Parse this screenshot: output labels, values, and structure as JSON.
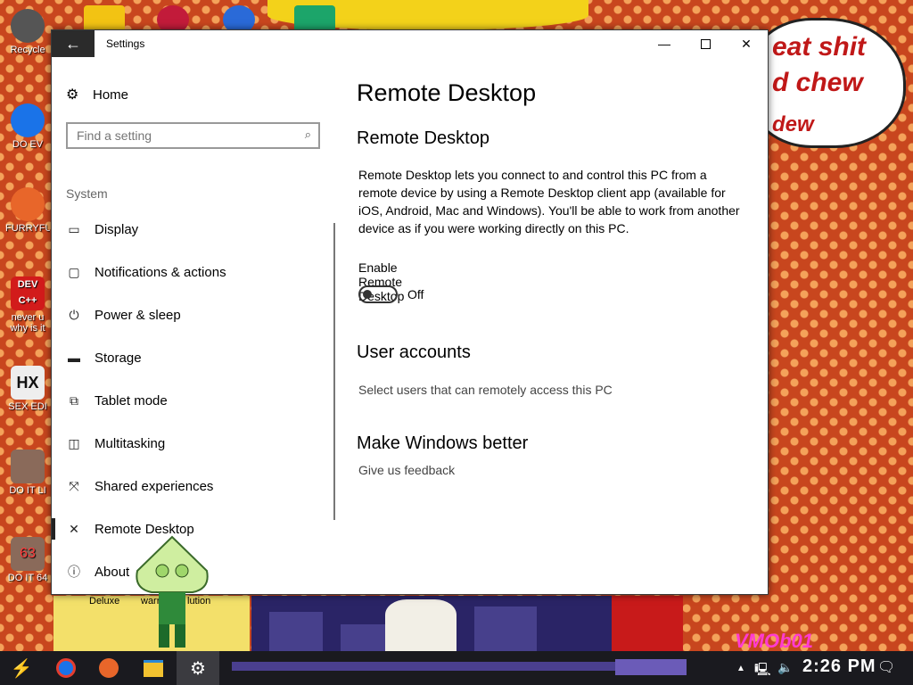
{
  "desktop": {
    "icons": [
      {
        "label": "Recycle",
        "color": "#6b6b6b"
      },
      {
        "label": "DO EV",
        "color": "#1a73e8"
      },
      {
        "label": "FURRYFU",
        "color": "#e8662a"
      },
      {
        "label": "never u",
        "label2": "why is it",
        "color": "#d21b1b",
        "text": "DEV C++"
      },
      {
        "label": "SEX EDI",
        "color": "#eeeeee",
        "text": "HX"
      },
      {
        "label": "DO IT LI",
        "color": "#8a6a5a"
      },
      {
        "label": "DO IT 64",
        "color": "#8a6a5a",
        "text": "63"
      }
    ],
    "bubble_lines": [
      "eat shit",
      "d chew",
      "d",
      "dew"
    ],
    "bottom_labels": [
      "Deluxe",
      "warr",
      "lution"
    ],
    "watermark": "VMOb01"
  },
  "window": {
    "title": "Settings",
    "back_glyph": "←",
    "min_glyph": "—",
    "close_glyph": "✕"
  },
  "sidebar": {
    "home_label": "Home",
    "search_placeholder": "Find a setting",
    "section_label": "System",
    "items": [
      {
        "label": "Display",
        "icon": "display-icon",
        "glyph": "▭"
      },
      {
        "label": "Notifications & actions",
        "icon": "notifications-icon",
        "glyph": "▢"
      },
      {
        "label": "Power & sleep",
        "icon": "power-icon",
        "glyph": "⏻"
      },
      {
        "label": "Storage",
        "icon": "storage-icon",
        "glyph": "▬"
      },
      {
        "label": "Tablet mode",
        "icon": "tablet-mode-icon",
        "glyph": "⧉"
      },
      {
        "label": "Multitasking",
        "icon": "multitasking-icon",
        "glyph": "◫"
      },
      {
        "label": "Shared experiences",
        "icon": "shared-experiences-icon",
        "glyph": "⤧"
      },
      {
        "label": "Remote Desktop",
        "icon": "remote-desktop-icon",
        "glyph": "✕"
      },
      {
        "label": "About",
        "icon": "about-icon",
        "glyph": "ⓘ"
      }
    ],
    "active_index": 7
  },
  "main": {
    "page_title": "Remote Desktop",
    "section_title": "Remote Desktop",
    "description": "Remote Desktop lets you connect to and control this PC from a remote device by using a Remote Desktop client app (available for iOS, Android, Mac and Windows). You'll be able to work from another device as if you were working directly on this PC.",
    "enable_label": "Enable Remote Desktop",
    "toggle_state": "Off",
    "toggle_on": false,
    "user_accounts_title": "User accounts",
    "user_accounts_link": "Select users that can remotely access this PC",
    "make_better_title": "Make Windows better",
    "feedback_link": "Give us feedback"
  },
  "taskbar": {
    "clock": "2:26 PM",
    "colors": {
      "bar": "#1a1a1f",
      "active": "#3b3b40"
    }
  }
}
